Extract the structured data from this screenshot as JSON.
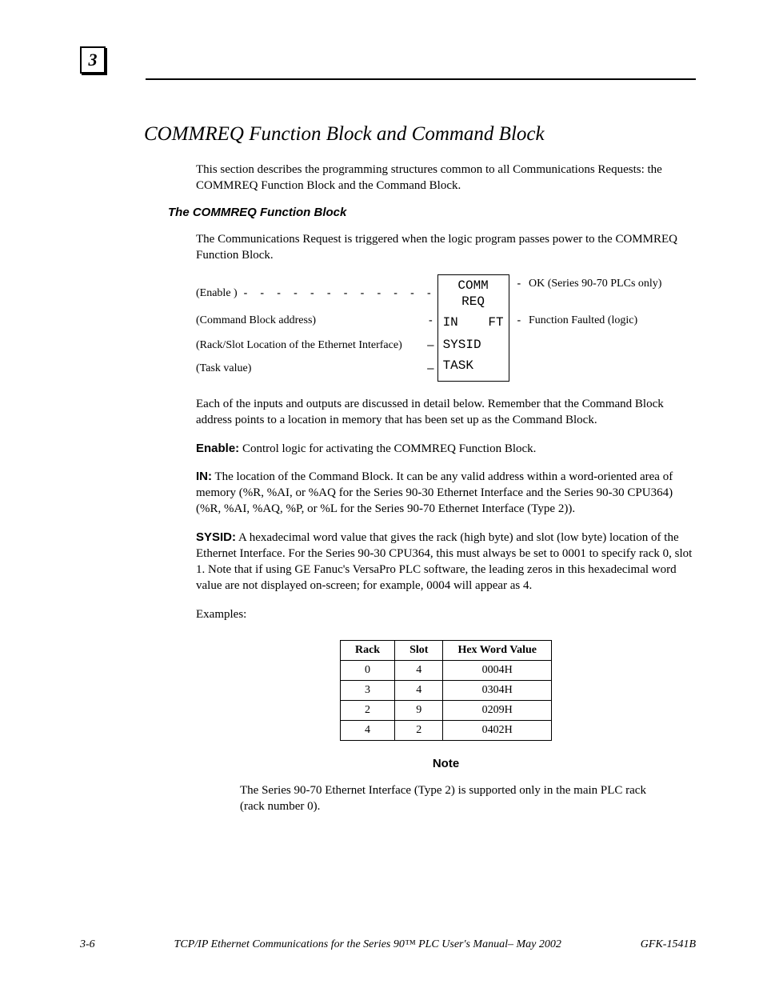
{
  "chapter_number": "3",
  "main_heading": "COMMREQ Function Block and Command Block",
  "intro_para": "This section describes the programming structures common to all Communications Requests: the COMMREQ Function Block and the Command Block.",
  "sub_heading": "The COMMREQ Function Block",
  "sub_para": "The Communications Request is triggered when the logic program passes power to the COMMREQ Function Block.",
  "fb": {
    "enable_label": "(Enable )",
    "cmd_label": "(Command Block address)",
    "rack_label_1": "(Rack/Slot Location of",
    "rack_label_2": " the Ethernet Interface)",
    "task_label": "(Task value)",
    "box_top_1": "COMM",
    "box_top_2": "REQ",
    "box_in": "IN",
    "box_ft": "FT",
    "box_sysid": "SYSID",
    "box_task": "TASK",
    "out_ok": "OK (Series 90-70 PLCs only)",
    "out_ft": "Function Faulted (logic)"
  },
  "after_diagram": "Each of the inputs and outputs are discussed in detail below.  Remember that the Command Block address points to a location in memory that has been set up as the Command Block.",
  "enable_def_label": "Enable:",
  "enable_def": "  Control logic for activating the COMMREQ Function Block.",
  "in_def_label": "IN:",
  "in_def": "  The location of the Command Block.  It can be any valid address within a word-oriented area of memory (%R, %AI, or %AQ for the Series 90-30 Ethernet Interface and the Series 90-30 CPU364) (%R, %AI, %AQ, %P, or %L for the Series 90-70 Ethernet Interface (Type 2)).",
  "sysid_def_label": "SYSID:",
  "sysid_def": "  A hexadecimal word value that gives the rack (high byte) and slot (low byte) location of the Ethernet Interface.  For the Series 90-30 CPU364, this must always be set to 0001 to specify rack 0, slot 1.  Note that if using GE Fanuc's VersaPro PLC software, the leading zeros in this hexadecimal word value are not displayed on-screen; for example, 0004 will appear as 4.",
  "examples_label": "Examples:",
  "table": {
    "headers": {
      "rack": "Rack",
      "slot": "Slot",
      "hex": "Hex Word Value"
    },
    "rows": [
      {
        "rack": "0",
        "slot": "4",
        "hex": "0004H"
      },
      {
        "rack": "3",
        "slot": "4",
        "hex": "0304H"
      },
      {
        "rack": "2",
        "slot": "9",
        "hex": "0209H"
      },
      {
        "rack": "4",
        "slot": "2",
        "hex": "0402H"
      }
    ]
  },
  "note_heading": "Note",
  "note_text": "The Series 90-70 Ethernet Interface (Type 2) is supported only in the main PLC rack (rack number 0).",
  "footer": {
    "left": "3-6",
    "center": "TCP/IP Ethernet Communications for the Series 90™ PLC User's Manual– May 2002",
    "right": "GFK-1541B"
  }
}
